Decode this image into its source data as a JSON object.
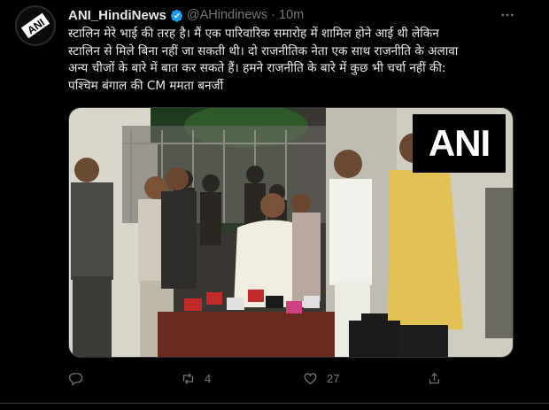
{
  "tweet": {
    "display_name": "ANI_HindiNews",
    "handle": "@AHindinews",
    "separator": "·",
    "time": "10m",
    "avatar_logo_text": "ANI",
    "more_icon": "more-horizontal-icon",
    "text_lines": [
      "स्टालिन मेरे भाई की तरह है। मैं एक पारिवारिक समारोह में शामिल होने आई थी लेकिन",
      "स्टालिन से मिले बिना नहीं जा सकती थी। दो राजनीतिक नेता एक साथ राजनीति के अलावा",
      "अन्य चीजों के बारे में बात कर सकते हैं। हमने राजनीति के बारे में कुछ भी चर्चा नहीं की:",
      "पश्चिम बंगाल की CM ममता बनर्जी"
    ],
    "media": {
      "watermark": "ANI"
    },
    "actions": {
      "reply_count": "",
      "retweet_count": "4",
      "like_count": "27",
      "share_count": ""
    }
  },
  "colors": {
    "background": "#000000",
    "text": "#e7e9ea",
    "muted": "#71767b",
    "verified": "#1d9bf0"
  }
}
